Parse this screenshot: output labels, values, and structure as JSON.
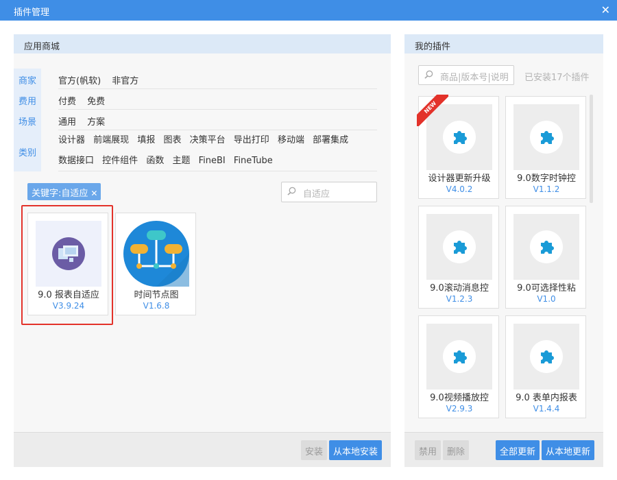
{
  "window": {
    "title": "插件管理",
    "close_glyph": "✕"
  },
  "left_panel": {
    "header": "应用商城",
    "filters": [
      {
        "category": "商家",
        "items": [
          "官方(帆软)",
          "非官方"
        ]
      },
      {
        "category": "费用",
        "items": [
          "付费",
          "免费"
        ]
      },
      {
        "category": "场景",
        "items": [
          "通用",
          "方案"
        ]
      },
      {
        "category": "类别",
        "items": [
          "设计器",
          "前端展现",
          "填报",
          "图表",
          "决策平台",
          "导出打印",
          "移动端",
          "部署集成",
          "数据接口",
          "控件组件",
          "函数",
          "主题",
          "FineBI",
          "FineTube"
        ]
      }
    ],
    "keyword_tag": {
      "label": "关键字:自适应",
      "remove_glyph": "✕"
    },
    "search": {
      "value": "自适应",
      "icon": "search-icon"
    },
    "plugins": [
      {
        "name": "9.0 报表自适应",
        "version": "V3.9.24",
        "icon": "report-adaptive-icon",
        "highlighted": true
      },
      {
        "name": "时间节点图",
        "version": "V1.6.8",
        "icon": "timeline-nodes-icon",
        "highlighted": false
      }
    ],
    "buttons": {
      "install": "安装",
      "install_local": "从本地安装"
    }
  },
  "right_panel": {
    "header": "我的插件",
    "search": {
      "placeholder": "商品|版本号|说明",
      "icon": "search-icon"
    },
    "installed_count": "已安装17个插件",
    "plugins": [
      {
        "name": "设计器更新升级",
        "version": "V4.0.2",
        "badge": "NEW",
        "icon": "puzzle-icon"
      },
      {
        "name": "9.0数字时钟控",
        "version": "V1.1.2",
        "icon": "puzzle-icon"
      },
      {
        "name": "9.0滚动消息控",
        "version": "V1.2.3",
        "icon": "puzzle-icon"
      },
      {
        "name": "9.0可选择性粘",
        "version": "V1.0",
        "icon": "puzzle-icon"
      },
      {
        "name": "9.0视频播放控",
        "version": "V2.9.3",
        "icon": "puzzle-icon"
      },
      {
        "name": "9.0 表单内报表",
        "version": "V1.4.4",
        "icon": "puzzle-icon"
      }
    ],
    "buttons": {
      "disable": "禁用",
      "delete": "删除",
      "update_all": "全部更新",
      "update_local": "从本地更新"
    }
  },
  "colors": {
    "accent": "#3f8ee6",
    "title_bar": "#3f8ee6",
    "highlight_border": "#e3322a",
    "puzzle_blue": "#1a9bd7"
  }
}
